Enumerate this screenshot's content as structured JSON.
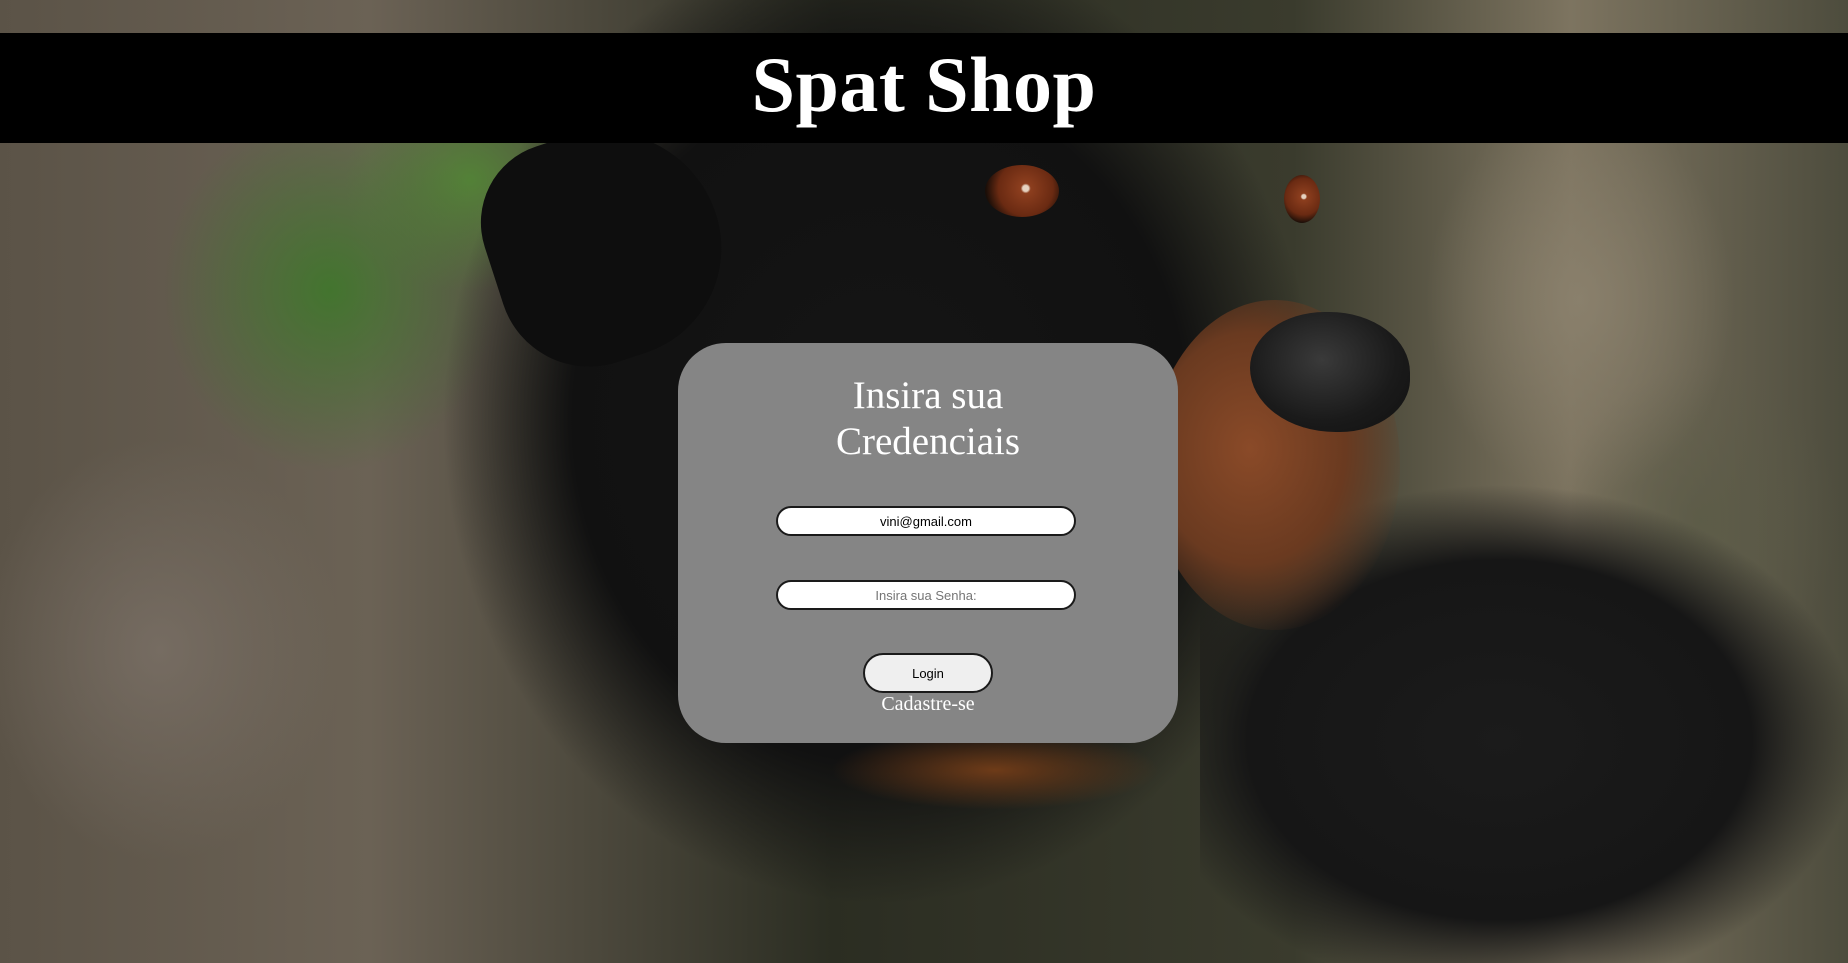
{
  "header": {
    "title": "Spat Shop"
  },
  "login": {
    "title": "Insira sua Credenciais",
    "email_value": "vini@gmail.com",
    "password_placeholder": "Insira sua Senha:",
    "login_label": "Login",
    "signup_label": "Cadastre-se"
  },
  "colors": {
    "header_bg": "#000000",
    "card_bg": "#858585",
    "text": "#ffffff"
  }
}
